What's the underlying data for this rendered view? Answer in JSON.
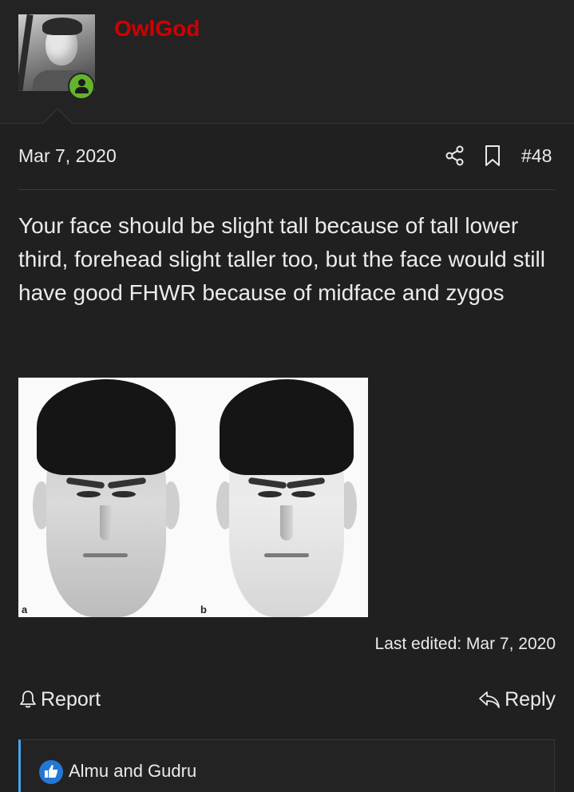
{
  "post": {
    "author": "OwlGod",
    "date": "Mar 7, 2020",
    "number": "#48",
    "body": "Your face should be slight tall because of tall lower third, forehead slight taller too, but the face would still have good FHWR because of midface and zygos",
    "image_labels": {
      "a": "a",
      "b": "b"
    },
    "last_edited": "Last edited: Mar 7, 2020"
  },
  "actions": {
    "report": "Report",
    "reply": "Reply"
  },
  "reactions": {
    "text": "Almu and Gudru"
  },
  "icons": {
    "share": "share-icon",
    "bookmark": "bookmark-icon",
    "report": "bell-icon",
    "reply": "reply-arrow-icon",
    "like": "thumbs-up-icon",
    "online": "online-user-icon"
  },
  "colors": {
    "username": "#d00000",
    "background": "#202020",
    "online": "#63b32b",
    "like": "#2577d6",
    "reactions_accent": "#47a7eb"
  }
}
